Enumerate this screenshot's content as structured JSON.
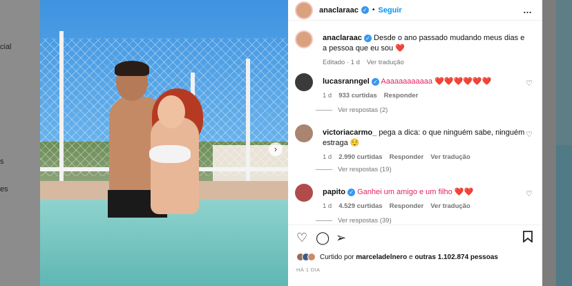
{
  "background": {
    "left_texts": [
      "cial",
      "s",
      "es"
    ]
  },
  "post": {
    "author": "anaclaraac",
    "follow_label": "Seguir",
    "separator": "•",
    "more_icon": "…",
    "caption": "Desde o ano passado mudando meus dias e a pessoa que eu sou ❤️",
    "edited": "Editado · 1 d",
    "translate_label": "Ver tradução"
  },
  "comments": [
    {
      "user": "lucasranngel",
      "verified": true,
      "text": "Aaaaaaaaaaaa ❤️❤️❤️❤️❤️❤️",
      "age": "1 d",
      "likes": "933 curtidas",
      "reply": "Responder",
      "translate": "",
      "replies": "Ver respostas (2)"
    },
    {
      "user": "victoriacarmo_",
      "verified": false,
      "text": "pega a dica: o que ninguém sabe, ninguém estraga 😌",
      "age": "1 d",
      "likes": "2.990 curtidas",
      "reply": "Responder",
      "translate": "Ver tradução",
      "replies": "Ver respostas (19)"
    },
    {
      "user": "papito",
      "verified": true,
      "text": "Ganhei um amigo e um filho ❤️❤️",
      "age": "1 d",
      "likes": "4.529 curtidas",
      "reply": "Responder",
      "translate": "Ver tradução",
      "replies": "Ver respostas (39)"
    }
  ],
  "liked_by": {
    "prefix": "Curtido por",
    "user": "marceladelnero",
    "middle": "e",
    "others": "outras 1.102.874 pessoas"
  },
  "date": "HÁ 1 DIA",
  "icons": [
    "heart-icon",
    "comment-icon",
    "share-icon",
    "bookmark-icon",
    "verified-icon",
    "chevron-right-icon"
  ],
  "colors": {
    "accent": "#0095f6",
    "verified": "#3897f0",
    "muted": "#737373"
  }
}
